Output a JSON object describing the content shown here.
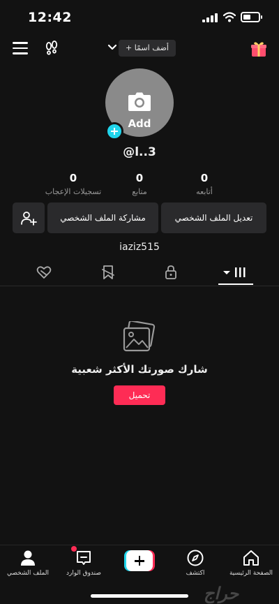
{
  "status_bar": {
    "time": "12:42"
  },
  "header": {
    "add_name_label": "+ أضف اسمًا"
  },
  "profile": {
    "avatar_add_label": "Add",
    "username": "@l..3",
    "handle": "iaziz515"
  },
  "stats": [
    {
      "value": "0",
      "label": "أتابعه"
    },
    {
      "value": "0",
      "label": "متابع"
    },
    {
      "value": "0",
      "label": "تسجيلات الإعجاب"
    }
  ],
  "actions": {
    "edit_profile": "تعديل الملف الشخصي",
    "share_profile": "مشاركة الملف الشخصي"
  },
  "empty_state": {
    "title": "شارك صورتك الأكثر شعبية",
    "upload_button": "تحميل"
  },
  "bottom_nav": {
    "home": "الصفحة الرئيسية",
    "discover": "اكتشف",
    "inbox": "صندوق الوارد",
    "profile": "الملف الشخصي"
  },
  "watermark": "حراج",
  "colors": {
    "accent_red": "#fe2c55",
    "accent_cyan": "#20d5ec",
    "background": "#121212"
  }
}
